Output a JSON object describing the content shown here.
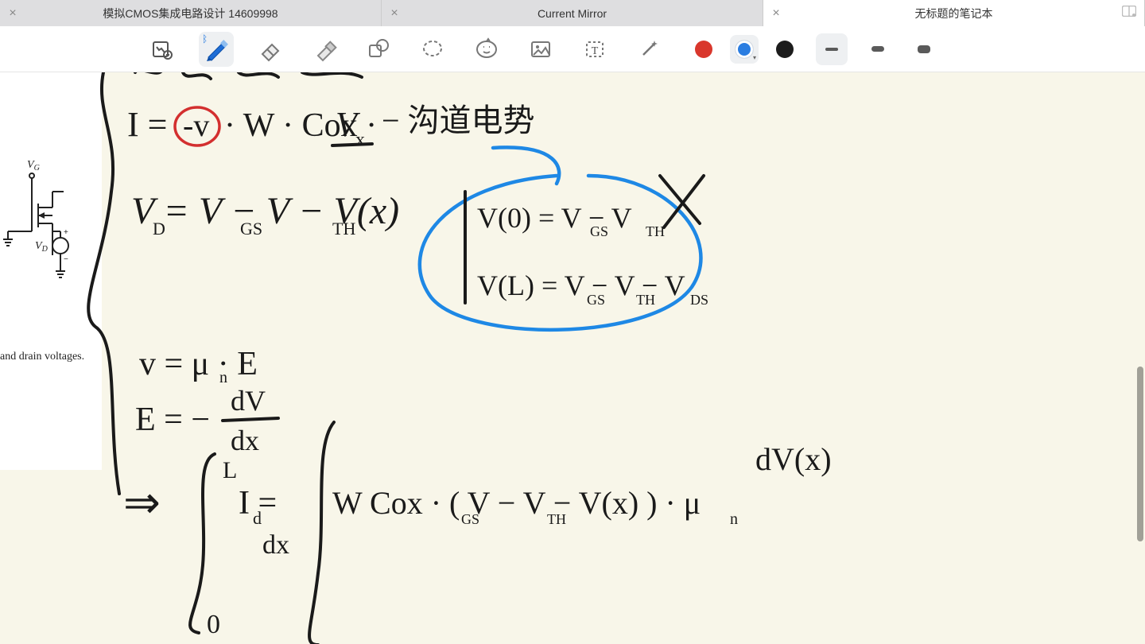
{
  "tabs": [
    {
      "title": "模拟CMOS集成电路设计 14609998",
      "active": false
    },
    {
      "title": "Current Mirror",
      "active": false
    },
    {
      "title": "无标题的笔记本",
      "active": true
    }
  ],
  "toolbar": {
    "tools": {
      "zoom": "zoom-add-icon",
      "pen": "pen-icon",
      "eraser": "eraser-icon",
      "highlighter": "highlighter-icon",
      "shape": "shape-icon",
      "lasso": "lasso-icon",
      "sticker": "sticker-icon",
      "image": "image-icon",
      "text": "text-icon",
      "magic": "magic-icon"
    },
    "colors": {
      "red": "#d9372c",
      "blue": "#2a7de1",
      "black": "#1c1c1c",
      "selected": "blue"
    },
    "strokes": {
      "thin": 3,
      "mediumW": 10,
      "thickW": 14,
      "selected": "thin"
    }
  },
  "canvas": {
    "ref_labels": {
      "vg": "V",
      "vg_sub": "G",
      "vd": "V",
      "vd_sub": "D"
    },
    "ref_caption": "and drain voltages.",
    "ink_text": {
      "eq1_I": "I =",
      "eq1_rest": "· W · Cox ·",
      "eq1_Vx": "V",
      "eq1_Vx_sub": "x",
      "eq1_neg": "-v",
      "eq1_cn": "− 沟道电势",
      "eq2": "V  =  V    − V     − V(x)",
      "eq2_s1": "D",
      "eq2_s2": "GS",
      "eq2_s3": "TH",
      "bc1": "V(0) = V   − V",
      "bc1_s1": "GS",
      "bc1_s2": "TH",
      "bc2": "V(L) = V   − V    − V",
      "bc2_s1": "GS",
      "bc2_s2": "TH",
      "bc2_s3": "DS",
      "eq3a": "v = μ  · E",
      "eq3a_s": "n",
      "eq3b_lhs": "E = −",
      "eq3b_num": "dV",
      "eq3b_den": "dx",
      "arrow": "⇒",
      "int_top": "L",
      "int_bot": "0",
      "eq4_lhs": "I  =",
      "eq4_lhs_s": "d",
      "eq4_dz": "dx",
      "eq4_body": "W Cox · ( V    − V     − V(x) ) · μ",
      "eq4_s1": "GS",
      "eq4_s2": "TH",
      "eq4_mu": "n",
      "eq4_dv": "dV(x)",
      "cross": "×"
    }
  }
}
